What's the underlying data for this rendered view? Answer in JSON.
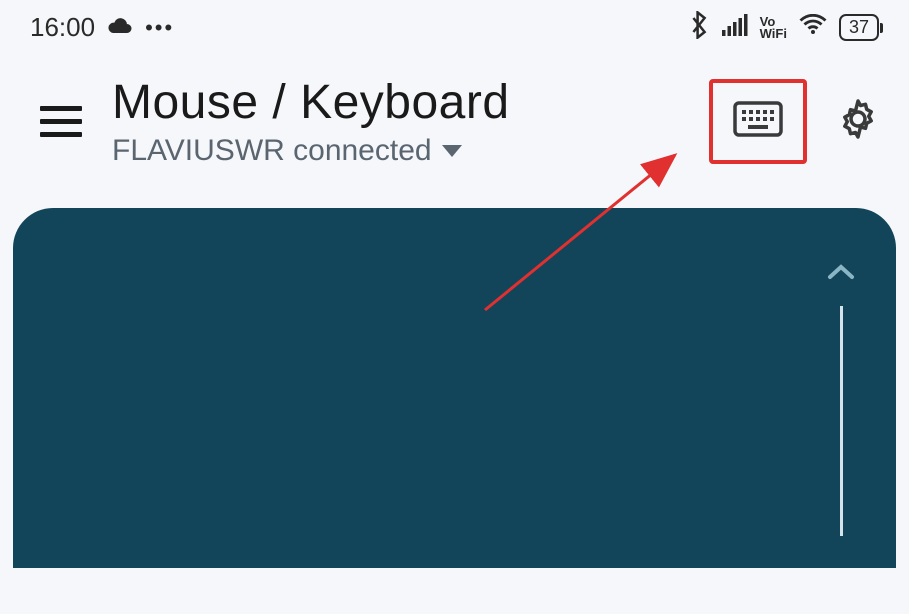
{
  "statusBar": {
    "time": "16:00",
    "battery": "37",
    "vowifi_line1": "Vo",
    "vowifi_line2": "WiFi"
  },
  "header": {
    "title": "Mouse / Keyboard",
    "subtitle": "FLAVIUSWR connected"
  }
}
